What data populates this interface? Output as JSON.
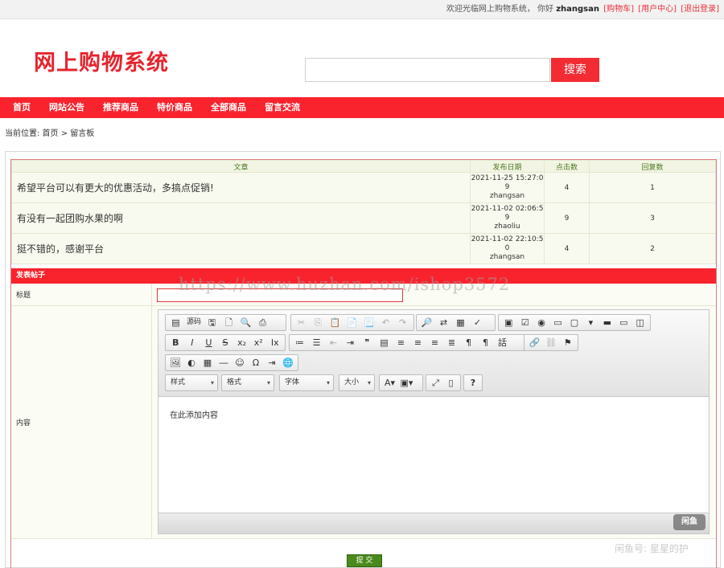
{
  "topbar": {
    "welcome": "欢迎光临网上购物系统，",
    "hello": "你好",
    "username": "zhangsan",
    "cart_link": "[购物车]",
    "user_center_link": "[用户中心]",
    "logout_link": "[退出登录]"
  },
  "header": {
    "logo": "网上购物系统",
    "search_placeholder": "",
    "search_button": "搜索"
  },
  "nav": {
    "items": [
      "首页",
      "网站公告",
      "推荐商品",
      "特价商品",
      "全部商品",
      "留言交流"
    ]
  },
  "breadcrumb": {
    "text": "当前位置: 首页 >  留言板"
  },
  "posts": {
    "headers": {
      "title": "文章",
      "date": "发布日期",
      "clicks": "点击数",
      "replies": "回复数"
    },
    "rows": [
      {
        "title": "希望平台可以有更大的优惠活动，多搞点促销!",
        "date_line1": "2021-11-25 15:27:0",
        "date_line2": "9",
        "author": "zhangsan",
        "clicks": "4",
        "replies": "1"
      },
      {
        "title": "有没有一起团购水果的啊",
        "date_line1": "2021-11-02 02:06:5",
        "date_line2": "9",
        "author": "zhaoliu",
        "clicks": "9",
        "replies": "3"
      },
      {
        "title": "挺不错的，感谢平台",
        "date_line1": "2021-11-02 22:10:5",
        "date_line2": "0",
        "author": "zhangsan",
        "clicks": "4",
        "replies": "2"
      }
    ]
  },
  "form": {
    "heading": "发表帖子",
    "title_label": "标题",
    "title_value": "",
    "content_label": "内容",
    "editor": {
      "source_label": "源码",
      "style_combo": "样式",
      "format_combo": "格式",
      "font_combo": "字体",
      "size_combo": "大小",
      "placeholder_text": "在此添加内容",
      "badge": "闲鱼"
    },
    "submit_label": "提 交"
  },
  "watermarks": {
    "main": "https://www.huzhan.com/ishop3572",
    "corner": "闲鱼号: 星星的护"
  },
  "colors": {
    "brand_red": "#f8232d",
    "submit_green": "#4a8a1c",
    "table_header_text": "#4a7a1e"
  }
}
